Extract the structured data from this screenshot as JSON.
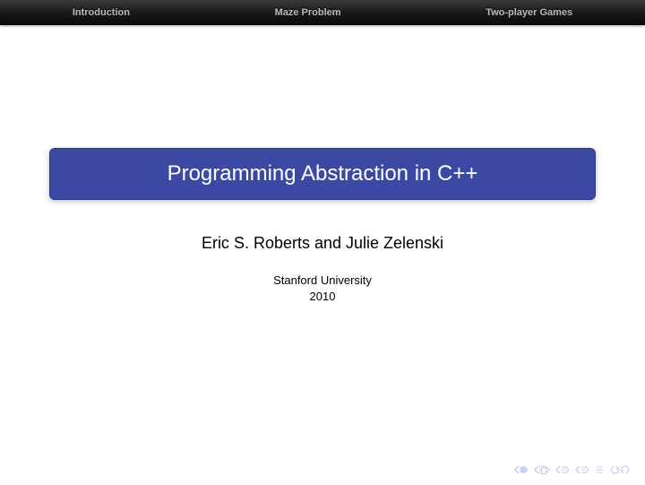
{
  "nav": {
    "items": [
      "Introduction",
      "Maze Problem",
      "Two-player Games"
    ]
  },
  "title": "Programming Abstraction in C++",
  "authors": "Eric S. Roberts and Julie Zelenski",
  "affiliation": "Stanford University",
  "year": "2010",
  "footer_icons": {
    "first": "first-slide",
    "prev": "previous-slide",
    "next_section_back": "prev-section",
    "next_section_fwd": "next-section",
    "end": "last-slide",
    "back": "go-back"
  }
}
